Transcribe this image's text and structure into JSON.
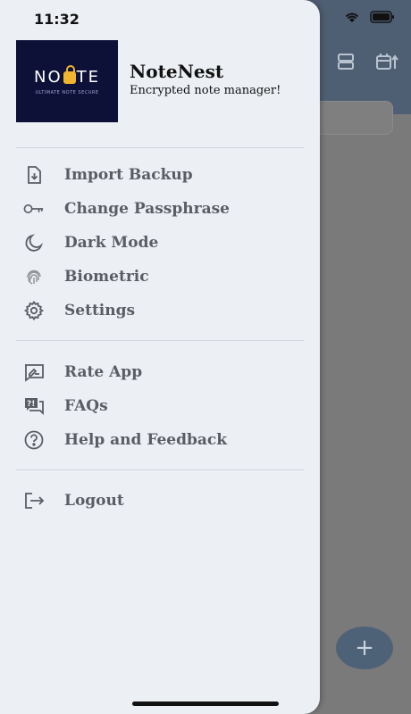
{
  "status": {
    "time": "11:32"
  },
  "app": {
    "name": "NoteNest",
    "subtitle": "Encrypted note manager!",
    "logo_text": "NOTE",
    "logo_tagline": "ULTIMATE NOTE SECURE"
  },
  "menu_primary": [
    {
      "label": "Import Backup",
      "icon": "import-file-icon"
    },
    {
      "label": "Change Passphrase",
      "icon": "key-icon"
    },
    {
      "label": "Dark Mode",
      "icon": "moon-icon"
    },
    {
      "label": "Biometric",
      "icon": "fingerprint-icon"
    },
    {
      "label": "Settings",
      "icon": "gear-icon"
    }
  ],
  "menu_secondary": [
    {
      "label": "Rate App",
      "icon": "rate-icon"
    },
    {
      "label": "FAQs",
      "icon": "faq-icon"
    },
    {
      "label": "Help and Feedback",
      "icon": "help-icon"
    }
  ],
  "menu_tertiary": [
    {
      "label": "Logout",
      "icon": "logout-icon"
    }
  ],
  "fab": {
    "label": "+"
  },
  "colors": {
    "drawer_bg": "#eceff4",
    "appbar": "#4f5f73",
    "label": "#5a5d63"
  }
}
